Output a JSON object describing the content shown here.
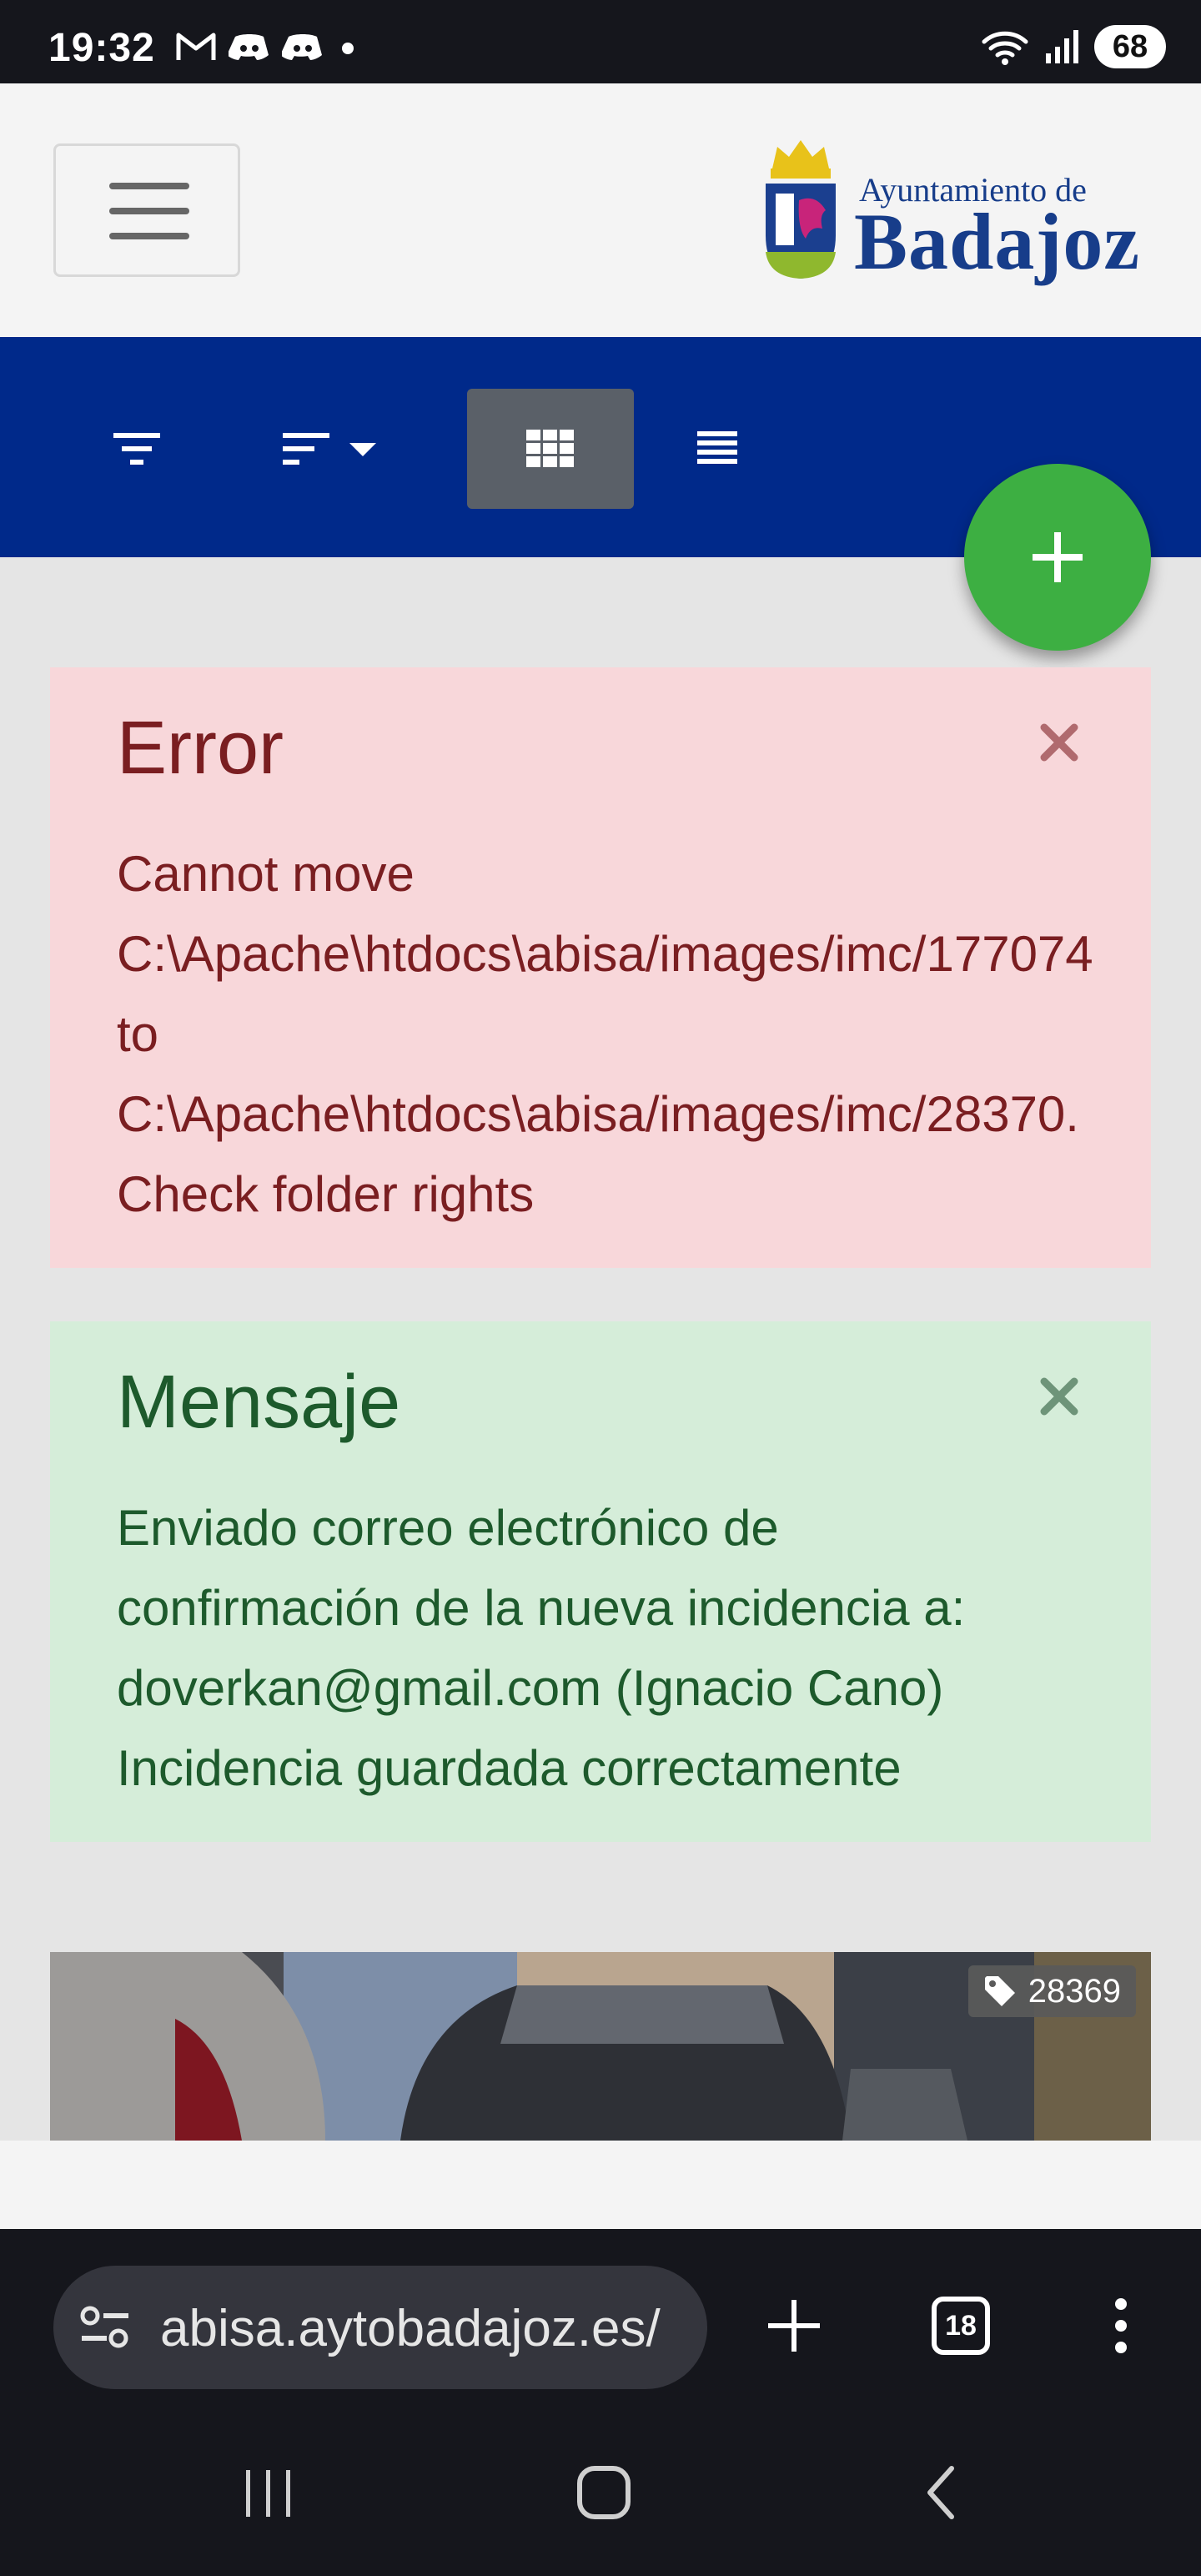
{
  "status_bar": {
    "time": "19:32",
    "left_icons": [
      "gmail-icon",
      "discord-icon",
      "discord-icon",
      "dot-icon"
    ],
    "right_icons": [
      "wifi-icon",
      "signal-icon"
    ],
    "battery": "68"
  },
  "header": {
    "logo_top": "Ayuntamiento de",
    "logo_main": "Badajoz"
  },
  "toolbar": {
    "items": [
      "filter-icon",
      "sort-icon",
      "grid-view-icon",
      "list-view-icon"
    ],
    "active": "grid-view-icon",
    "color": "#00298a"
  },
  "fab": {
    "icon": "plus-icon",
    "color": "#3daf42"
  },
  "alerts": {
    "error": {
      "title": "Error",
      "lines": [
        "Cannot move",
        "C:\\Apache\\htdocs\\abisa/images/imc/177074",
        "to",
        "C:\\Apache\\htdocs\\abisa/images/imc/28370.",
        "Check folder rights"
      ],
      "close": "×"
    },
    "message": {
      "title": "Mensaje",
      "lines": [
        "Enviado correo electrónico de",
        "confirmación de la nueva incidencia a:",
        "doverkan@gmail.com (Ignacio Cano)",
        "Incidencia guardada correctamente"
      ],
      "close": "×"
    }
  },
  "card": {
    "tag": "28369"
  },
  "browser": {
    "url": "abisa.aytobadajoz.es/",
    "tabs_count": "18"
  }
}
